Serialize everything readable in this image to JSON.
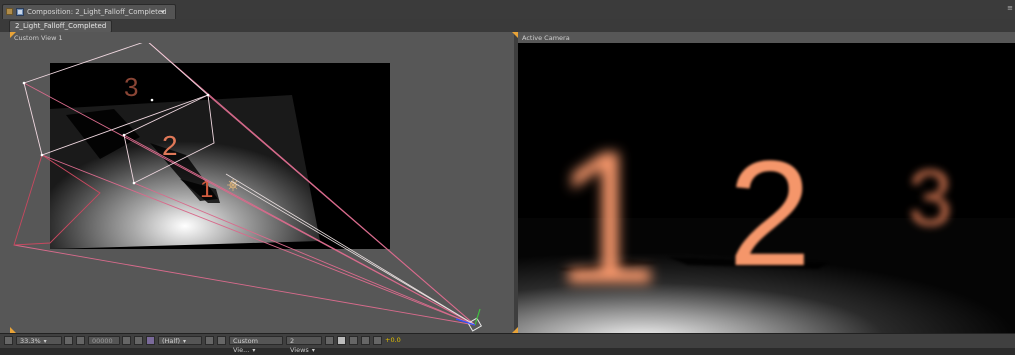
{
  "tab": {
    "title": "Composition: 2_Light_Falloff_Completed",
    "menu_glyph": "▾"
  },
  "panel_menu_glyph": "≡",
  "breadcrumb": {
    "label": "2_Light_Falloff_Completed"
  },
  "views": {
    "left": {
      "label": "Custom View 1"
    },
    "right": {
      "label": "Active Camera"
    }
  },
  "scene_numbers": {
    "one": "1",
    "two": "2",
    "three": "3"
  },
  "toolbar": {
    "zoom": "33.3%",
    "timecode": "00000",
    "resolution": "(Half)",
    "view": "Custom Vie...",
    "layout": "2 Views",
    "exposure": "+0.0"
  },
  "colors": {
    "accent": "#e8a338",
    "number_fill": "#f5966a",
    "frame_line": "#e06e8a"
  }
}
